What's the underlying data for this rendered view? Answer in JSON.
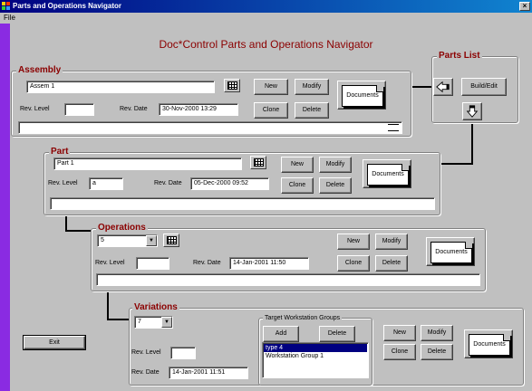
{
  "window": {
    "title": "Parts and Operations Navigator",
    "menu": [
      "File"
    ]
  },
  "heading": "Doc*Control Parts and Operations Navigator",
  "assembly": {
    "title": "Assembly",
    "name_value": "Assem 1",
    "rev_level_label": "Rev. Level",
    "rev_level_value": "",
    "rev_date_label": "Rev. Date",
    "rev_date_value": "30-Nov-2000  13:29",
    "new_label": "New",
    "modify_label": "Modify",
    "clone_label": "Clone",
    "delete_label": "Delete",
    "documents_label": "Documents"
  },
  "parts_list": {
    "title": "Parts List",
    "build_edit_label": "Build/Edit"
  },
  "part": {
    "title": "Part",
    "name_value": "Part 1",
    "rev_level_label": "Rev. Level",
    "rev_level_value": "a",
    "rev_date_label": "Rev. Date",
    "rev_date_value": "05-Dec-2000  09:52",
    "new_label": "New",
    "modify_label": "Modify",
    "clone_label": "Clone",
    "delete_label": "Delete",
    "documents_label": "Documents"
  },
  "operations": {
    "title": "Operations",
    "selected_value": "5",
    "rev_level_label": "Rev. Level",
    "rev_level_value": "",
    "rev_date_label": "Rev. Date",
    "rev_date_value": "14-Jan-2001  11:50",
    "new_label": "New",
    "modify_label": "Modify",
    "clone_label": "Clone",
    "delete_label": "Delete",
    "documents_label": "Documents"
  },
  "variations": {
    "title": "Variations",
    "selected_value": "7",
    "rev_level_label": "Rev. Level",
    "rev_level_value": "",
    "rev_date_label": "Rev. Date",
    "rev_date_value": "14-Jan-2001  11:51",
    "target_groups": {
      "title": "Target Workstation Groups",
      "add_label": "Add",
      "delete_label": "Delete",
      "items": [
        "type 4",
        "Workstation Group 1"
      ],
      "selected_index": 0
    },
    "new_label": "New",
    "modify_label": "Modify",
    "clone_label": "Clone",
    "delete_label": "Delete",
    "documents_label": "Documents"
  },
  "exit_label": "Exit",
  "colors": {
    "title_bar": "#000080",
    "heading": "#8b0000",
    "side_strip": "#8a2be2",
    "face": "#c0c0c0"
  },
  "icons": {
    "window": "app-grid-icon",
    "list_picker": "table-grid-icon",
    "parts_back": "arrow-left-icon",
    "parts_down": "arrow-down-icon"
  }
}
